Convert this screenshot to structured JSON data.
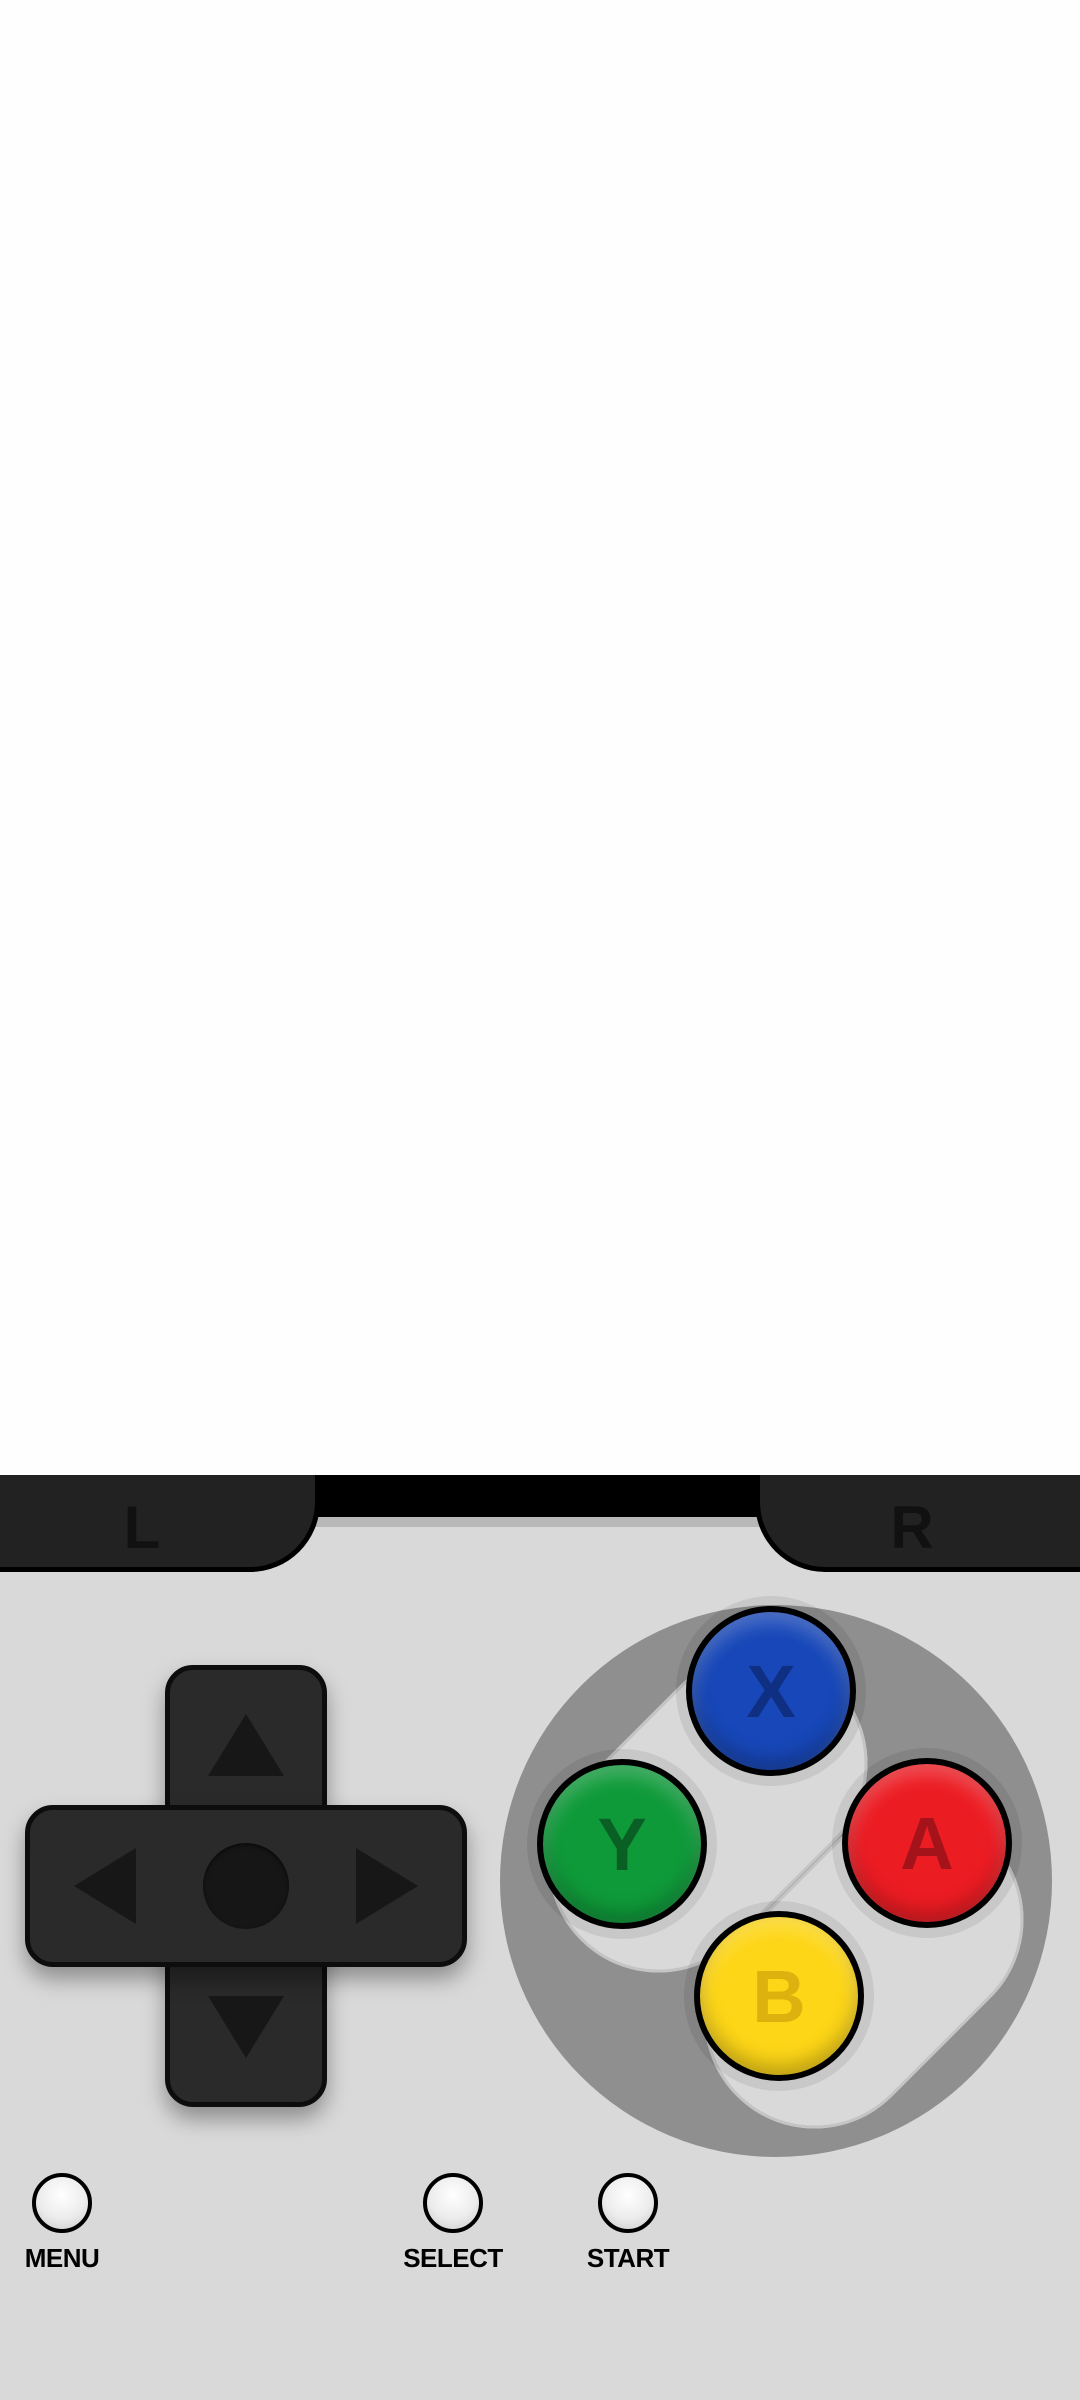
{
  "controller": {
    "shoulder_left": "L",
    "shoulder_right": "R",
    "face_buttons": {
      "x": "X",
      "y": "Y",
      "a": "A",
      "b": "B"
    },
    "menu_label": "MENU",
    "select_label": "SELECT",
    "start_label": "START"
  },
  "colors": {
    "x_button": "#1747b8",
    "y_button": "#0f9a3a",
    "a_button": "#ec1c23",
    "b_button": "#fdd617",
    "dpad": "#2a2a2a",
    "controller_body": "#d9d9d9"
  },
  "icons": {
    "dpad_up": "triangle-up-icon",
    "dpad_down": "triangle-down-icon",
    "dpad_left": "triangle-left-icon",
    "dpad_right": "triangle-right-icon"
  }
}
